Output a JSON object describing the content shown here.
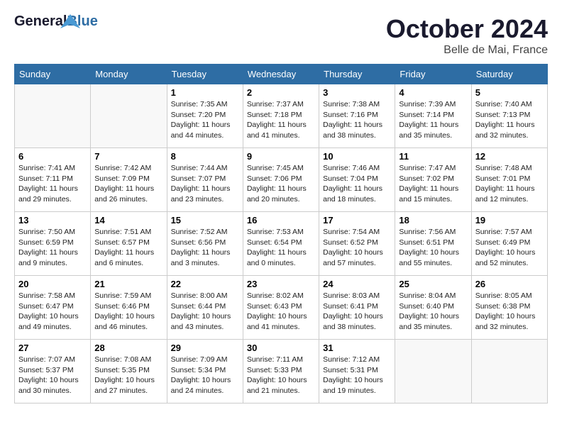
{
  "header": {
    "logo_general": "General",
    "logo_blue": "Blue",
    "month": "October 2024",
    "location": "Belle de Mai, France"
  },
  "days_of_week": [
    "Sunday",
    "Monday",
    "Tuesday",
    "Wednesday",
    "Thursday",
    "Friday",
    "Saturday"
  ],
  "weeks": [
    [
      {
        "num": "",
        "sunrise": "",
        "sunset": "",
        "daylight": ""
      },
      {
        "num": "",
        "sunrise": "",
        "sunset": "",
        "daylight": ""
      },
      {
        "num": "1",
        "sunrise": "Sunrise: 7:35 AM",
        "sunset": "Sunset: 7:20 PM",
        "daylight": "Daylight: 11 hours and 44 minutes."
      },
      {
        "num": "2",
        "sunrise": "Sunrise: 7:37 AM",
        "sunset": "Sunset: 7:18 PM",
        "daylight": "Daylight: 11 hours and 41 minutes."
      },
      {
        "num": "3",
        "sunrise": "Sunrise: 7:38 AM",
        "sunset": "Sunset: 7:16 PM",
        "daylight": "Daylight: 11 hours and 38 minutes."
      },
      {
        "num": "4",
        "sunrise": "Sunrise: 7:39 AM",
        "sunset": "Sunset: 7:14 PM",
        "daylight": "Daylight: 11 hours and 35 minutes."
      },
      {
        "num": "5",
        "sunrise": "Sunrise: 7:40 AM",
        "sunset": "Sunset: 7:13 PM",
        "daylight": "Daylight: 11 hours and 32 minutes."
      }
    ],
    [
      {
        "num": "6",
        "sunrise": "Sunrise: 7:41 AM",
        "sunset": "Sunset: 7:11 PM",
        "daylight": "Daylight: 11 hours and 29 minutes."
      },
      {
        "num": "7",
        "sunrise": "Sunrise: 7:42 AM",
        "sunset": "Sunset: 7:09 PM",
        "daylight": "Daylight: 11 hours and 26 minutes."
      },
      {
        "num": "8",
        "sunrise": "Sunrise: 7:44 AM",
        "sunset": "Sunset: 7:07 PM",
        "daylight": "Daylight: 11 hours and 23 minutes."
      },
      {
        "num": "9",
        "sunrise": "Sunrise: 7:45 AM",
        "sunset": "Sunset: 7:06 PM",
        "daylight": "Daylight: 11 hours and 20 minutes."
      },
      {
        "num": "10",
        "sunrise": "Sunrise: 7:46 AM",
        "sunset": "Sunset: 7:04 PM",
        "daylight": "Daylight: 11 hours and 18 minutes."
      },
      {
        "num": "11",
        "sunrise": "Sunrise: 7:47 AM",
        "sunset": "Sunset: 7:02 PM",
        "daylight": "Daylight: 11 hours and 15 minutes."
      },
      {
        "num": "12",
        "sunrise": "Sunrise: 7:48 AM",
        "sunset": "Sunset: 7:01 PM",
        "daylight": "Daylight: 11 hours and 12 minutes."
      }
    ],
    [
      {
        "num": "13",
        "sunrise": "Sunrise: 7:50 AM",
        "sunset": "Sunset: 6:59 PM",
        "daylight": "Daylight: 11 hours and 9 minutes."
      },
      {
        "num": "14",
        "sunrise": "Sunrise: 7:51 AM",
        "sunset": "Sunset: 6:57 PM",
        "daylight": "Daylight: 11 hours and 6 minutes."
      },
      {
        "num": "15",
        "sunrise": "Sunrise: 7:52 AM",
        "sunset": "Sunset: 6:56 PM",
        "daylight": "Daylight: 11 hours and 3 minutes."
      },
      {
        "num": "16",
        "sunrise": "Sunrise: 7:53 AM",
        "sunset": "Sunset: 6:54 PM",
        "daylight": "Daylight: 11 hours and 0 minutes."
      },
      {
        "num": "17",
        "sunrise": "Sunrise: 7:54 AM",
        "sunset": "Sunset: 6:52 PM",
        "daylight": "Daylight: 10 hours and 57 minutes."
      },
      {
        "num": "18",
        "sunrise": "Sunrise: 7:56 AM",
        "sunset": "Sunset: 6:51 PM",
        "daylight": "Daylight: 10 hours and 55 minutes."
      },
      {
        "num": "19",
        "sunrise": "Sunrise: 7:57 AM",
        "sunset": "Sunset: 6:49 PM",
        "daylight": "Daylight: 10 hours and 52 minutes."
      }
    ],
    [
      {
        "num": "20",
        "sunrise": "Sunrise: 7:58 AM",
        "sunset": "Sunset: 6:47 PM",
        "daylight": "Daylight: 10 hours and 49 minutes."
      },
      {
        "num": "21",
        "sunrise": "Sunrise: 7:59 AM",
        "sunset": "Sunset: 6:46 PM",
        "daylight": "Daylight: 10 hours and 46 minutes."
      },
      {
        "num": "22",
        "sunrise": "Sunrise: 8:00 AM",
        "sunset": "Sunset: 6:44 PM",
        "daylight": "Daylight: 10 hours and 43 minutes."
      },
      {
        "num": "23",
        "sunrise": "Sunrise: 8:02 AM",
        "sunset": "Sunset: 6:43 PM",
        "daylight": "Daylight: 10 hours and 41 minutes."
      },
      {
        "num": "24",
        "sunrise": "Sunrise: 8:03 AM",
        "sunset": "Sunset: 6:41 PM",
        "daylight": "Daylight: 10 hours and 38 minutes."
      },
      {
        "num": "25",
        "sunrise": "Sunrise: 8:04 AM",
        "sunset": "Sunset: 6:40 PM",
        "daylight": "Daylight: 10 hours and 35 minutes."
      },
      {
        "num": "26",
        "sunrise": "Sunrise: 8:05 AM",
        "sunset": "Sunset: 6:38 PM",
        "daylight": "Daylight: 10 hours and 32 minutes."
      }
    ],
    [
      {
        "num": "27",
        "sunrise": "Sunrise: 7:07 AM",
        "sunset": "Sunset: 5:37 PM",
        "daylight": "Daylight: 10 hours and 30 minutes."
      },
      {
        "num": "28",
        "sunrise": "Sunrise: 7:08 AM",
        "sunset": "Sunset: 5:35 PM",
        "daylight": "Daylight: 10 hours and 27 minutes."
      },
      {
        "num": "29",
        "sunrise": "Sunrise: 7:09 AM",
        "sunset": "Sunset: 5:34 PM",
        "daylight": "Daylight: 10 hours and 24 minutes."
      },
      {
        "num": "30",
        "sunrise": "Sunrise: 7:11 AM",
        "sunset": "Sunset: 5:33 PM",
        "daylight": "Daylight: 10 hours and 21 minutes."
      },
      {
        "num": "31",
        "sunrise": "Sunrise: 7:12 AM",
        "sunset": "Sunset: 5:31 PM",
        "daylight": "Daylight: 10 hours and 19 minutes."
      },
      {
        "num": "",
        "sunrise": "",
        "sunset": "",
        "daylight": ""
      },
      {
        "num": "",
        "sunrise": "",
        "sunset": "",
        "daylight": ""
      }
    ]
  ]
}
